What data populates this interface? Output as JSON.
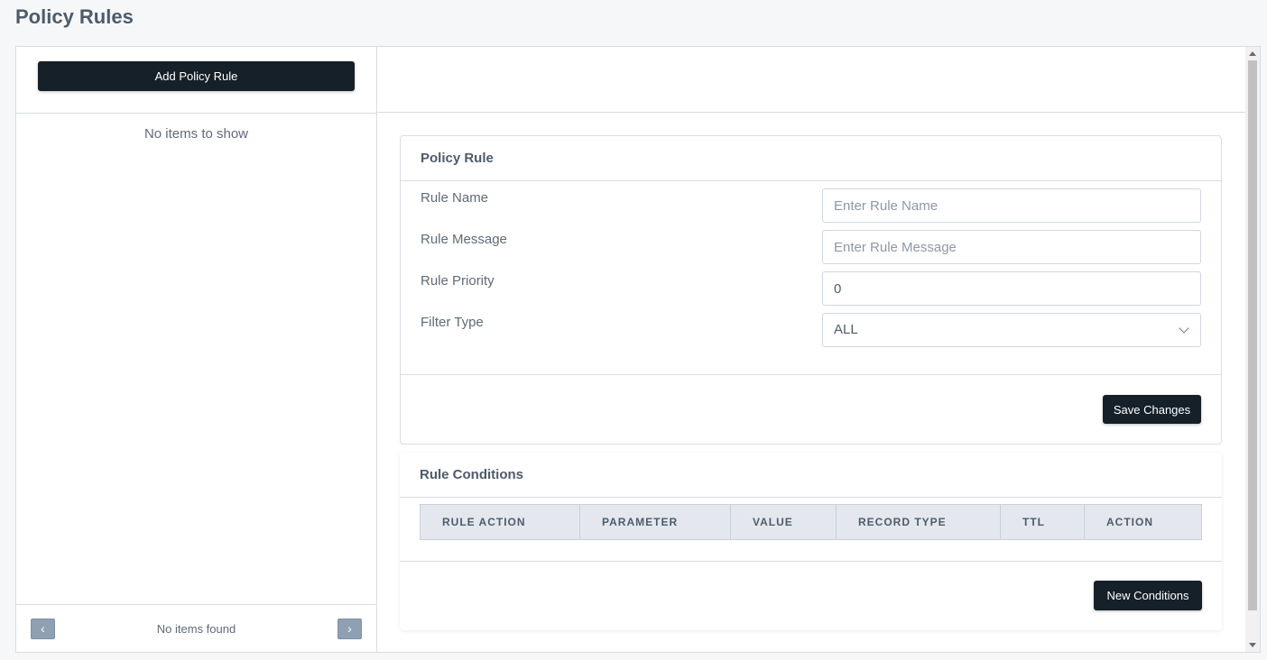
{
  "page": {
    "title": "Policy Rules"
  },
  "sidebar": {
    "add_button_label": "Add Policy Rule",
    "empty_message": "No items to show",
    "pager": {
      "prev_icon": "‹",
      "next_icon": "›",
      "status": "No items found"
    }
  },
  "policy_rule": {
    "title": "Policy Rule",
    "fields": {
      "rule_name": {
        "label": "Rule Name",
        "placeholder": "Enter Rule Name",
        "value": ""
      },
      "rule_message": {
        "label": "Rule Message",
        "placeholder": "Enter Rule Message",
        "value": ""
      },
      "rule_priority": {
        "label": "Rule Priority",
        "value": "0"
      },
      "filter_type": {
        "label": "Filter Type",
        "selected": "ALL"
      }
    },
    "save_label": "Save Changes"
  },
  "rule_conditions": {
    "title": "Rule Conditions",
    "columns": [
      "RULE ACTION",
      "PARAMETER",
      "VALUE",
      "RECORD TYPE",
      "TTL",
      "ACTION"
    ],
    "new_label": "New Conditions"
  }
}
